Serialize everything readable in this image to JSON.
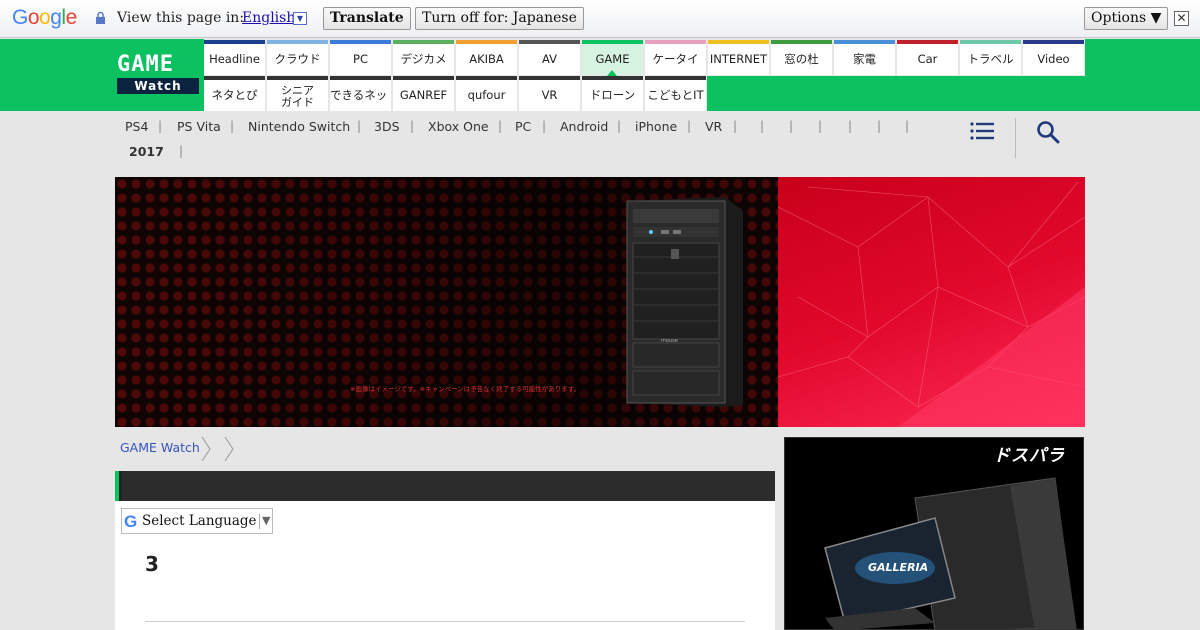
{
  "translate_bar": {
    "logo_letters": [
      "G",
      "o",
      "o",
      "g",
      "l",
      "e"
    ],
    "logo_colors": [
      "#4285f4",
      "#ea4335",
      "#fbbc05",
      "#4285f4",
      "#34a853",
      "#ea4335"
    ],
    "prompt": "View this page in:",
    "language": "English",
    "translate_button": "Translate",
    "turn_off_button": "Turn off for: Japanese",
    "options_button": "Options ▼",
    "close": "✕"
  },
  "logo": {
    "top": "GAME",
    "bottom": "Watch"
  },
  "nav": {
    "row1": [
      {
        "label": "Headline",
        "color": "#1b3f8b"
      },
      {
        "label": "クラウド",
        "color": "#7fb2e0"
      },
      {
        "label": "PC",
        "color": "#3d7bd8"
      },
      {
        "label": "デジカメ",
        "color": "#59b05f"
      },
      {
        "label": "AKIBA",
        "color": "#f0a030"
      },
      {
        "label": "AV",
        "color": "#555555"
      },
      {
        "label": "GAME",
        "color": "#0cc15f"
      },
      {
        "label": "ケータイ",
        "color": "#e8a0c0"
      },
      {
        "label": "INTERNET",
        "color": "#f0c020"
      },
      {
        "label": "窓の杜",
        "color": "#3d9a3d"
      },
      {
        "label": "家電",
        "color": "#4a90d9"
      },
      {
        "label": "Car",
        "color": "#c0202a"
      },
      {
        "label": "トラベル",
        "color": "#6dc9a8"
      },
      {
        "label": "Video",
        "color": "#2a3a8a"
      }
    ],
    "row2": [
      {
        "label": "ネタとぴ",
        "color": "#333333"
      },
      {
        "label": "シニア ガイド",
        "color": "#333333"
      },
      {
        "label": "できるネット",
        "color": "#333333"
      },
      {
        "label": "GANREF",
        "color": "#333333"
      },
      {
        "label": "qufour",
        "color": "#333333"
      },
      {
        "label": "VR",
        "color": "#333333"
      },
      {
        "label": "ドローン",
        "color": "#333333"
      },
      {
        "label": "こどもとIT",
        "color": "#333333"
      }
    ]
  },
  "subnav": {
    "items": [
      "PS4",
      "PS Vita",
      "Nintendo Switch",
      "3DS",
      "Xbox One",
      "PC",
      "Android",
      "iPhone",
      "VR"
    ],
    "year": "2017"
  },
  "banner": {
    "note": "※画像はイメージです。※キャンペーンは予告なく終了する可能性があります。",
    "pc_logo": "mouse"
  },
  "breadcrumb": {
    "home": "GAME Watch"
  },
  "language_select": {
    "label": "Select Language",
    "arrow": "▼",
    "g": "G"
  },
  "article": {
    "number": "3"
  },
  "ad": {
    "brand": "ドスパラ",
    "product": "GALLERIA"
  },
  "colors": {
    "site_green": "#0cc15f",
    "link_blue": "#3355bb"
  }
}
